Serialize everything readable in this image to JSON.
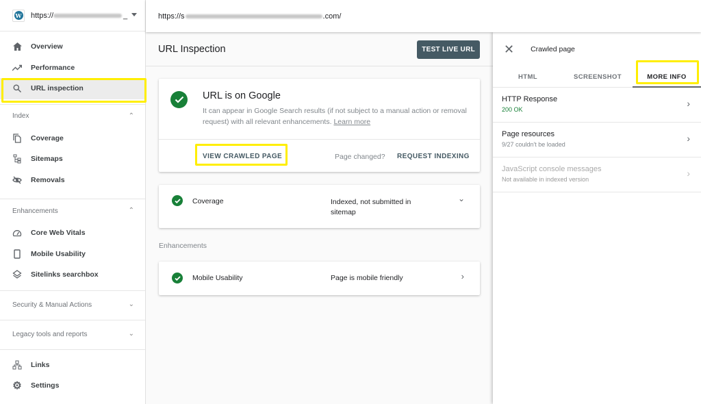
{
  "sidebar": {
    "property_url": "https://",
    "items": [
      {
        "label": "Overview"
      },
      {
        "label": "Performance"
      },
      {
        "label": "URL inspection"
      }
    ],
    "index_section": {
      "title": "Index",
      "items": [
        {
          "label": "Coverage"
        },
        {
          "label": "Sitemaps"
        },
        {
          "label": "Removals"
        }
      ]
    },
    "enh_section": {
      "title": "Enhancements",
      "items": [
        {
          "label": "Core Web Vitals"
        },
        {
          "label": "Mobile Usability"
        },
        {
          "label": "Sitelinks searchbox"
        }
      ]
    },
    "security": "Security & Manual Actions",
    "legacy": "Legacy tools and reports",
    "bottom": [
      {
        "label": "Links"
      },
      {
        "label": "Settings"
      }
    ]
  },
  "topbar": {
    "url_prefix": "https://s",
    "url_suffix": ".com/"
  },
  "main": {
    "title": "URL Inspection",
    "test_live": "TEST LIVE URL",
    "verdict": {
      "title": "URL is on Google",
      "desc": "It can appear in Google Search results (if not subject to a manual action or removal request) with all relevant enhancements.",
      "learn_more": "Learn more",
      "view_crawled": "VIEW CRAWLED PAGE",
      "page_changed": "Page changed?",
      "request_indexing": "REQUEST INDEXING"
    },
    "coverage": {
      "label": "Coverage",
      "value": "Indexed, not submitted in sitemap"
    },
    "enhancements_label": "Enhancements",
    "mobile": {
      "label": "Mobile Usability",
      "value": "Page is mobile friendly"
    }
  },
  "panel": {
    "title": "Crawled page",
    "tabs": [
      "HTML",
      "SCREENSHOT",
      "MORE INFO"
    ],
    "items": [
      {
        "title": "HTTP Response",
        "sub": "200 OK"
      },
      {
        "title": "Page resources",
        "sub": "9/27 couldn't be loaded"
      },
      {
        "title": "JavaScript console messages",
        "sub": "Not available in indexed version"
      }
    ]
  },
  "colors": {
    "highlight": "#ffee00",
    "success": "#188038",
    "button": "#455a64"
  }
}
